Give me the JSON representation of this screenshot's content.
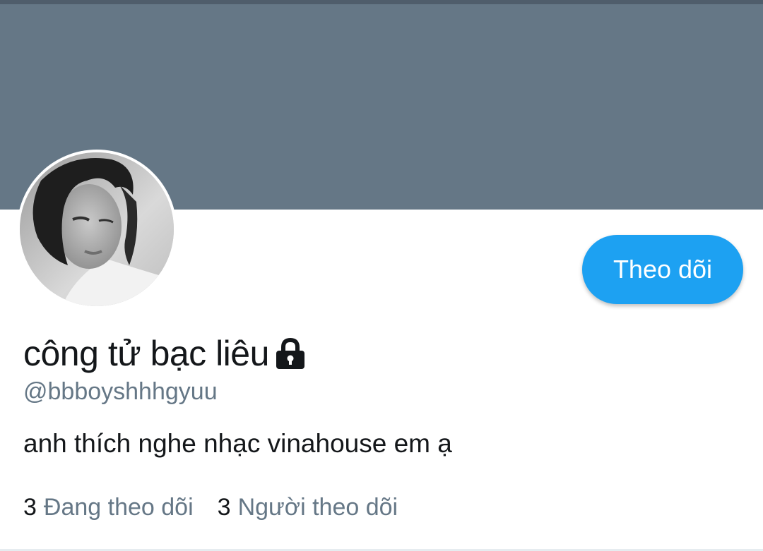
{
  "profile": {
    "display_name": "công tử bạc liêu",
    "handle": "@bbboyshhhgyuu",
    "bio": "anh thích nghe nhạc vinahouse em ạ",
    "protected_icon": "lock-icon",
    "avatar": "profile-photo"
  },
  "actions": {
    "follow_label": "Theo dõi"
  },
  "stats": {
    "following_count": "3",
    "following_label": "Đang theo dõi",
    "followers_count": "3",
    "followers_label": "Người theo dõi"
  },
  "colors": {
    "banner": "#657786",
    "accent": "#1da1f2",
    "primary_text": "#14171a",
    "secondary_text": "#657786"
  }
}
